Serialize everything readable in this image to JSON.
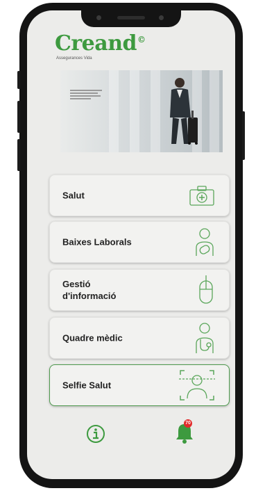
{
  "app": {
    "logo": "Creand",
    "logo_mark": "©",
    "subtitle": "Assegurances Vida"
  },
  "menu": [
    {
      "label": "Salut",
      "icon": "medical-kit-icon"
    },
    {
      "label": "Baixes Laborals",
      "icon": "person-bandage-icon"
    },
    {
      "label": "Gestió d'informació",
      "icon": "mouse-icon"
    },
    {
      "label": "Quadre mèdic",
      "icon": "person-stethoscope-icon"
    },
    {
      "label": "Selfie Salut",
      "icon": "face-scan-icon"
    }
  ],
  "bottom_nav": {
    "info_icon": "info-icon",
    "notification_icon": "bell-icon",
    "badge": "70"
  },
  "colors": {
    "brand_green": "#3d9a3f",
    "badge_red": "#e22b2b"
  }
}
